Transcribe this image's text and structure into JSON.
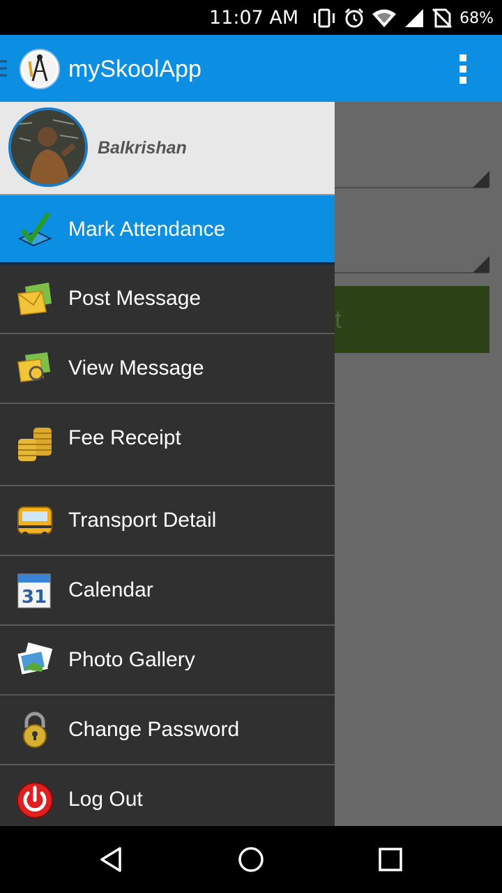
{
  "status_bar": {
    "time": "11:07 AM",
    "battery": "68%",
    "icons": [
      "vibrate-icon",
      "alarm-icon",
      "wifi-icon",
      "signal-icon",
      "no-sim-icon",
      "battery-icon"
    ]
  },
  "app_bar": {
    "title": "mySkoolApp",
    "color": "#0c8fe3"
  },
  "drawer": {
    "user_name": "Balkrishan",
    "items": [
      {
        "label": "Mark Attendance",
        "icon": "checkmark-icon",
        "active": true
      },
      {
        "label": "Post Message",
        "icon": "envelope-icon",
        "active": false
      },
      {
        "label": "View Message",
        "icon": "envelope-search-icon",
        "active": false
      },
      {
        "label": "Fee Receipt",
        "icon": "coins-icon",
        "active": false
      },
      {
        "label": "Transport Detail",
        "icon": "school-bus-icon",
        "active": false
      },
      {
        "label": "Calendar",
        "icon": "calendar-icon",
        "active": false
      },
      {
        "label": "Photo Gallery",
        "icon": "photos-icon",
        "active": false
      },
      {
        "label": "Change Password",
        "icon": "padlock-icon",
        "active": false
      },
      {
        "label": "Log Out",
        "icon": "power-icon",
        "active": false
      }
    ],
    "calendar_day": "31"
  },
  "background": {
    "button_text": "t",
    "button_color": "#2b4116"
  },
  "nav_bar": {
    "buttons": [
      "back-icon",
      "home-icon",
      "recents-icon"
    ]
  }
}
